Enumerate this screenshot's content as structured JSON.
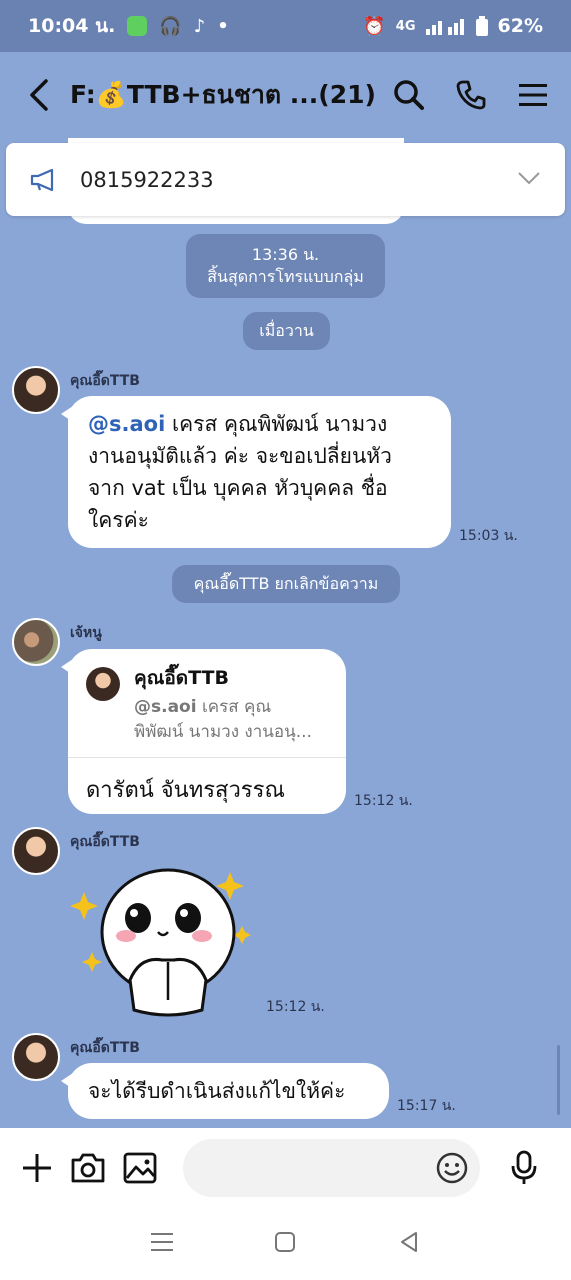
{
  "status_bar": {
    "time": "10:04 น.",
    "battery": "62%",
    "network": "4G"
  },
  "header": {
    "title": "F:💰TTB+ธนชาต ...(21)"
  },
  "announcement": {
    "text": "0815922233"
  },
  "system": {
    "call_time": "13:36 น.",
    "call_end": "สิ้นสุดการโทรแบบกลุ่ม",
    "date_label": "เมื่อวาน",
    "unsent": "คุณอี๊ดTTB ยกเลิกข้อความ"
  },
  "messages": [
    {
      "sender": "คุณอี๊ดTTB",
      "mention": "@s.aoi",
      "text_line1": " เครส คุณพิพัฒน์ นามวง",
      "text_line2": "งานอนุมัติแล้ว ค่ะ จะขอเปลี่ยนหัว",
      "text_line3": "จาก vat เป็น บุคคล  หัวบุคคล ชื่อ",
      "text_line4": "ใครค่ะ",
      "time": "15:03 น."
    },
    {
      "sender": "เจ้หนู",
      "reply_name": "คุณอี๊ดTTB",
      "reply_mention": "@s.aoi",
      "reply_line1": " เครส คุณ",
      "reply_line2": "พิพัฒน์ นามวง  งานอนุ...",
      "text": "ดารัตน์ จันทรสุวรรณ",
      "time": "15:12 น."
    },
    {
      "sender": "คุณอี๊ดTTB",
      "sticker": "cute-face-sticker",
      "time": "15:12 น."
    },
    {
      "sender": "คุณอี๊ดTTB",
      "text": "จะได้รีบดำเนินส่งแก้ไขให้ค่ะ",
      "time": "15:17 น."
    }
  ],
  "input": {
    "value": ""
  },
  "icons": {
    "back": "chevron-left-icon",
    "search": "search-icon",
    "call": "phone-icon",
    "menu": "hamburger-icon",
    "megaphone": "megaphone-icon",
    "plus": "plus-icon",
    "camera": "camera-icon",
    "image": "image-icon",
    "emoji": "emoji-icon",
    "mic": "mic-icon"
  },
  "colors": {
    "background": "#8aa6d6",
    "status_bar": "#6a82b2",
    "chip": "#6e86b6",
    "mention": "#2e63b8"
  }
}
